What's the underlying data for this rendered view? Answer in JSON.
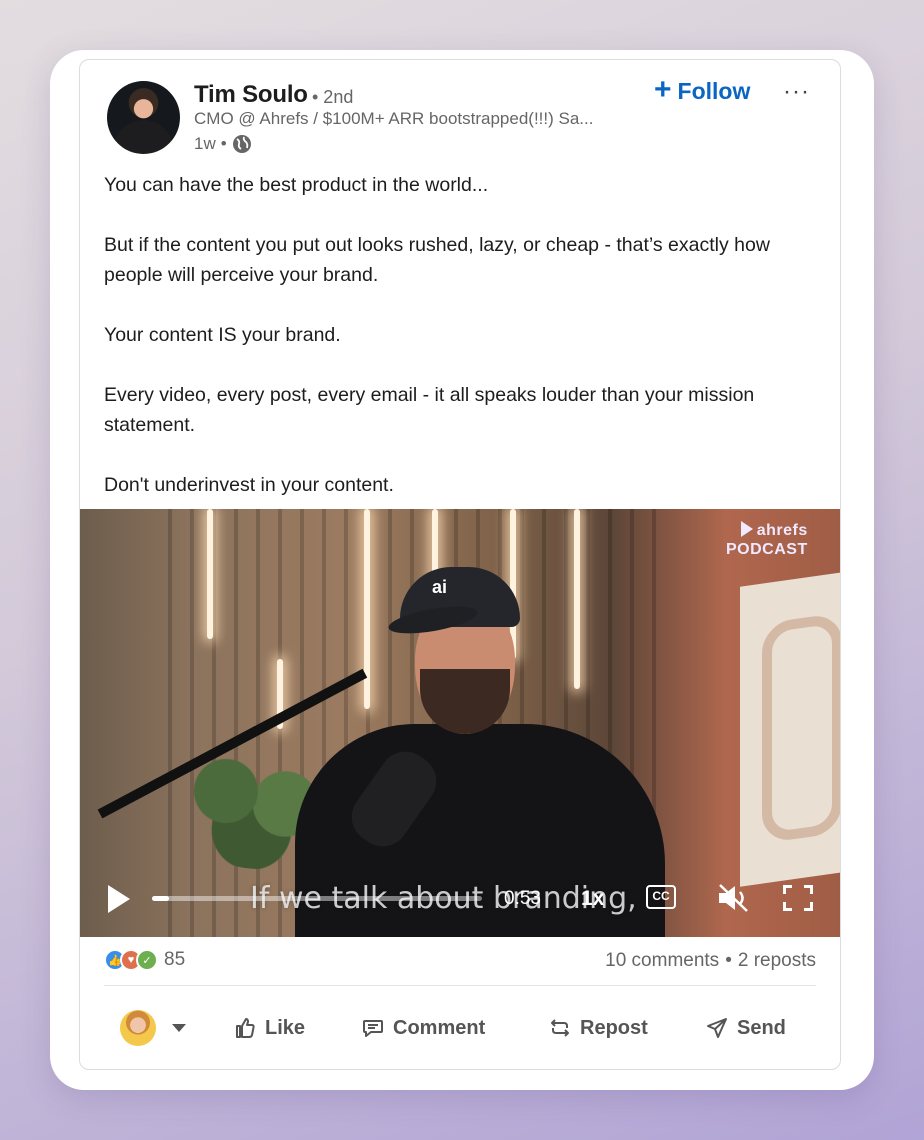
{
  "post": {
    "author": {
      "name": "Tim Soulo",
      "degree": "• 2nd",
      "headline": "CMO @ Ahrefs / $100M+ ARR bootstrapped(!!!) Sa...",
      "time": "1w",
      "separator": "•",
      "visibility_icon": "globe-icon"
    },
    "follow_label": "Follow",
    "more_label": "···",
    "body": [
      "You can have the best product in the world...",
      "But if the content you put out looks rushed, lazy, or cheap - that’s exactly how people will perceive your brand.",
      "Your content IS your brand.",
      "Every video, every post, every email - it all speaks louder than your mission statement.",
      "Don't underinvest in your content."
    ]
  },
  "video": {
    "brand_line1": "ahrefs",
    "brand_line2": "PODCAST",
    "cap_logo": "ai",
    "caption": "If we talk about branding,",
    "time": "0:53",
    "speed": "1x",
    "cc_label": "CC",
    "progress": 0.05
  },
  "social": {
    "reaction_count": "85",
    "comments": "10 comments",
    "dot": "•",
    "reposts": "2 reposts"
  },
  "actions": {
    "like": "Like",
    "comment": "Comment",
    "repost": "Repost",
    "send": "Send"
  },
  "colors": {
    "accent": "#0a66c2",
    "text": "#1d1d1d",
    "muted": "#666666"
  }
}
